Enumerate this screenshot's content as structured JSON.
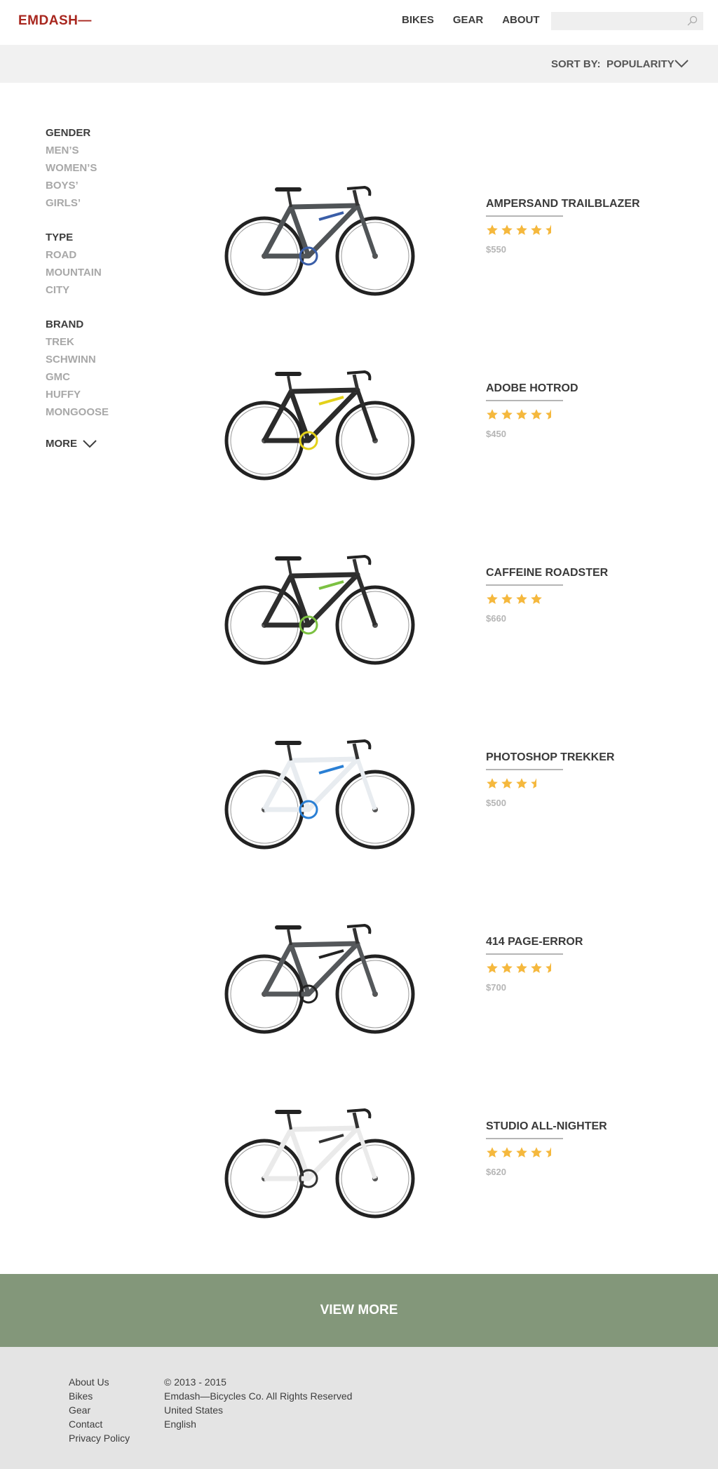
{
  "header": {
    "logo": "EMDASH—",
    "nav": [
      "BIKES",
      "GEAR",
      "ABOUT"
    ],
    "search": {
      "value": "",
      "placeholder": ""
    },
    "icons": {
      "search": "search-icon"
    }
  },
  "sort": {
    "label": "SORT BY:",
    "value": "POPULARITY"
  },
  "filters": {
    "groups": [
      {
        "heading": "GENDER",
        "items": [
          "MEN’S",
          "WOMEN’S",
          "BOYS’",
          "GIRLS’"
        ]
      },
      {
        "heading": "TYPE",
        "items": [
          "ROAD",
          "MOUNTAIN",
          "CITY"
        ]
      },
      {
        "heading": "BRAND",
        "items": [
          "TREK",
          "SCHWINN",
          "GMC",
          "HUFFY",
          "MONGOOSE"
        ]
      }
    ],
    "more": "MORE"
  },
  "products": [
    {
      "name": "AMPERSAND TRAILBLAZER",
      "rating": 4.5,
      "price": "$550",
      "frame_color": "#505457",
      "accent": "#3a5ea8"
    },
    {
      "name": "ADOBE HOTROD",
      "rating": 4.5,
      "price": "$450",
      "frame_color": "#2b2b2b",
      "accent": "#e3d11a"
    },
    {
      "name": "CAFFEINE ROADSTER",
      "rating": 4,
      "price": "$660",
      "frame_color": "#2e2e2e",
      "accent": "#7cc142"
    },
    {
      "name": "PHOTOSHOP TREKKER",
      "rating": 3.5,
      "price": "$500",
      "frame_color": "#e8ecf0",
      "accent": "#2a7fd4"
    },
    {
      "name": "414 PAGE-ERROR",
      "rating": 4.5,
      "price": "$700",
      "frame_color": "#55585b",
      "accent": "#222222"
    },
    {
      "name": "STUDIO ALL-NIGHTER",
      "rating": 4.5,
      "price": "$620",
      "frame_color": "#eaeaea",
      "accent": "#333333"
    }
  ],
  "view_more": "VIEW MORE",
  "footer": {
    "links": [
      "About Us",
      "Bikes",
      "Gear",
      "Contact",
      "Privacy Policy"
    ],
    "info": [
      "© 2013 - 2015",
      "Emdash—Bicycles Co. All Rights Reserved",
      "United States",
      "English"
    ]
  },
  "colors": {
    "brand": "#a8261e",
    "star": "#f5b83d",
    "view_more_bg": "#83977a",
    "footer_bg": "#e4e4e4"
  }
}
